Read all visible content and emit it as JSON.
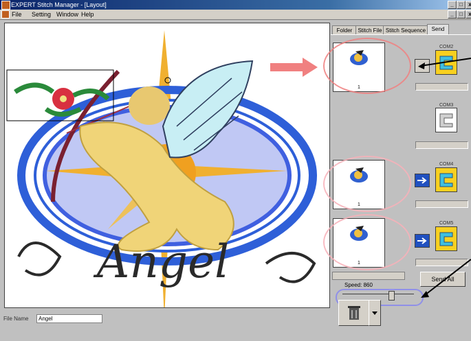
{
  "window": {
    "title": "EXPERT Stitch Manager - [Layout]",
    "controls": [
      "_",
      "□",
      "x"
    ],
    "doc_controls": [
      "_",
      "□",
      "x"
    ]
  },
  "menu": [
    "File",
    "Setting",
    "Window",
    "Help"
  ],
  "tabs": [
    {
      "label": "Folder",
      "active": false
    },
    {
      "label": "Stitch File",
      "active": false
    },
    {
      "label": "Stitch Sequence",
      "active": false
    },
    {
      "label": "Send",
      "active": true
    }
  ],
  "canvas": {
    "design_text": "Angel"
  },
  "status": {
    "label": "File Name",
    "value": "Angel"
  },
  "machines": [
    {
      "com": "COM2",
      "thumb_number": "1",
      "has_design": true,
      "active": true
    },
    {
      "com": "COM3",
      "thumb_number": "",
      "has_design": false,
      "active": false
    },
    {
      "com": "COM4",
      "thumb_number": "1",
      "has_design": true,
      "active": true
    },
    {
      "com": "COM5",
      "thumb_number": "1",
      "has_design": true,
      "active": true
    }
  ],
  "send_all_label": "Send All",
  "speed": {
    "label": "Speed:",
    "value": "860"
  },
  "colors": {
    "accent_pink": "#f08080",
    "machine_yellow": "#f8d020",
    "send_blue": "#2050c0",
    "title_blue": "#0a246a"
  },
  "icons": {
    "trash": "trash-icon",
    "dropdown": "chevron-down-icon",
    "send": "send-arrow-icon",
    "machine": "embroidery-machine-icon"
  }
}
